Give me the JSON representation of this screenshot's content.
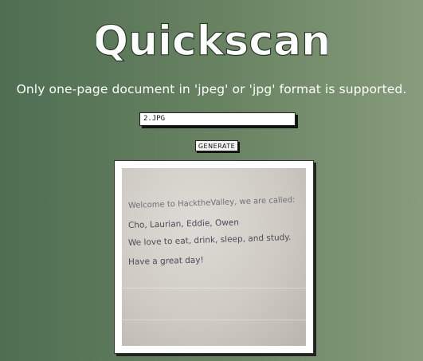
{
  "app": {
    "title": "Quickscan"
  },
  "notice": "Only one-page document in 'jpeg' or 'jpg' format is supported.",
  "file_input": {
    "value": "2.JPG"
  },
  "generate_button": {
    "label": "GENERATE"
  },
  "preview": {
    "lines": [
      "Welcome to HacktheValley, we are called:",
      "Cho, Laurian, Eddie, Owen",
      "We love to eat, drink, sleep, and study.",
      "Have a great day!"
    ]
  },
  "colors": {
    "background_left": "#4f6e52",
    "background_right": "#879c7c",
    "text": "#ffffff"
  }
}
